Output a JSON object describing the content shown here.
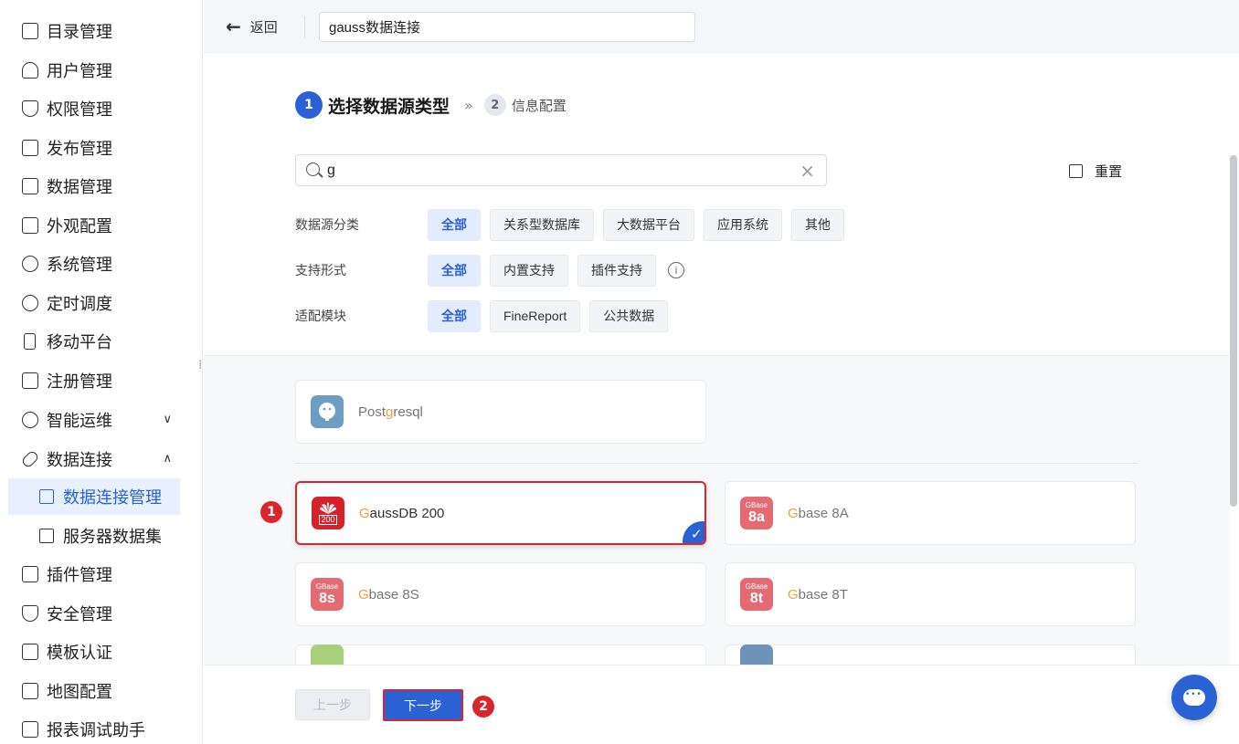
{
  "sidebar": {
    "items": [
      {
        "label": "目录管理",
        "icon": "list-icon"
      },
      {
        "label": "用户管理",
        "icon": "user-icon"
      },
      {
        "label": "权限管理",
        "icon": "shield-icon"
      },
      {
        "label": "发布管理",
        "icon": "publish-icon"
      },
      {
        "label": "数据管理",
        "icon": "database-icon"
      },
      {
        "label": "外观配置",
        "icon": "appearance-icon"
      },
      {
        "label": "系统管理",
        "icon": "gear-icon"
      },
      {
        "label": "定时调度",
        "icon": "timer-icon"
      },
      {
        "label": "移动平台",
        "icon": "mobile-icon"
      },
      {
        "label": "注册管理",
        "icon": "register-icon"
      },
      {
        "label": "智能运维",
        "icon": "ops-icon"
      },
      {
        "label": "数据连接",
        "icon": "link-icon"
      },
      {
        "label": "插件管理",
        "icon": "plugin-icon"
      },
      {
        "label": "安全管理",
        "icon": "security-icon"
      },
      {
        "label": "模板认证",
        "icon": "template-icon"
      },
      {
        "label": "地图配置",
        "icon": "map-icon"
      },
      {
        "label": "报表调试助手",
        "icon": "debug-icon"
      }
    ],
    "sub_items": [
      {
        "label": "数据连接管理",
        "icon": "server-icon"
      },
      {
        "label": "服务器数据集",
        "icon": "dataset-icon"
      }
    ],
    "chevrons": {
      "ops": "∨",
      "data_connection": "∧"
    }
  },
  "topbar": {
    "back_label": "返回",
    "back_arrow": "←",
    "connection_name": "gauss数据连接"
  },
  "steps": {
    "step1_num": "1",
    "step1_title": "选择数据源类型",
    "separator": "»",
    "step2_num": "2",
    "step2_title": "信息配置"
  },
  "search": {
    "value": "g",
    "clear": "×"
  },
  "reset_label": "重置",
  "filters": {
    "category_label": "数据源分类",
    "category_options": [
      "全部",
      "关系型数据库",
      "大数据平台",
      "应用系统",
      "其他"
    ],
    "support_label": "支持形式",
    "support_options": [
      "全部",
      "内置支持",
      "插件支持"
    ],
    "module_label": "适配模块",
    "module_options": [
      "全部",
      "FineReport",
      "公共数据"
    ],
    "info_icon": "i"
  },
  "cards": {
    "postgresql": {
      "pre": "Post",
      "hl": "g",
      "post": "resql"
    },
    "gaussdb": {
      "hl": "G",
      "post": "aussDB 200",
      "logo_text": "200"
    },
    "gbase8a": {
      "hl": "G",
      "post": "base 8A",
      "logo_top": "GBase",
      "logo_bot": "8a"
    },
    "gbase8s": {
      "hl": "G",
      "post": "base 8S",
      "logo_top": "GBase",
      "logo_bot": "8s"
    },
    "gbase8t": {
      "hl": "G",
      "post": "base 8T",
      "logo_top": "GBase",
      "logo_bot": "8t"
    }
  },
  "footer": {
    "prev_label": "上一步",
    "next_label": "下一步"
  },
  "markers": {
    "m1": "1",
    "m2": "2"
  },
  "colors": {
    "primary": "#2a62d6",
    "highlight_border": "#d9262c",
    "match_highlight": "#e8a33d"
  }
}
